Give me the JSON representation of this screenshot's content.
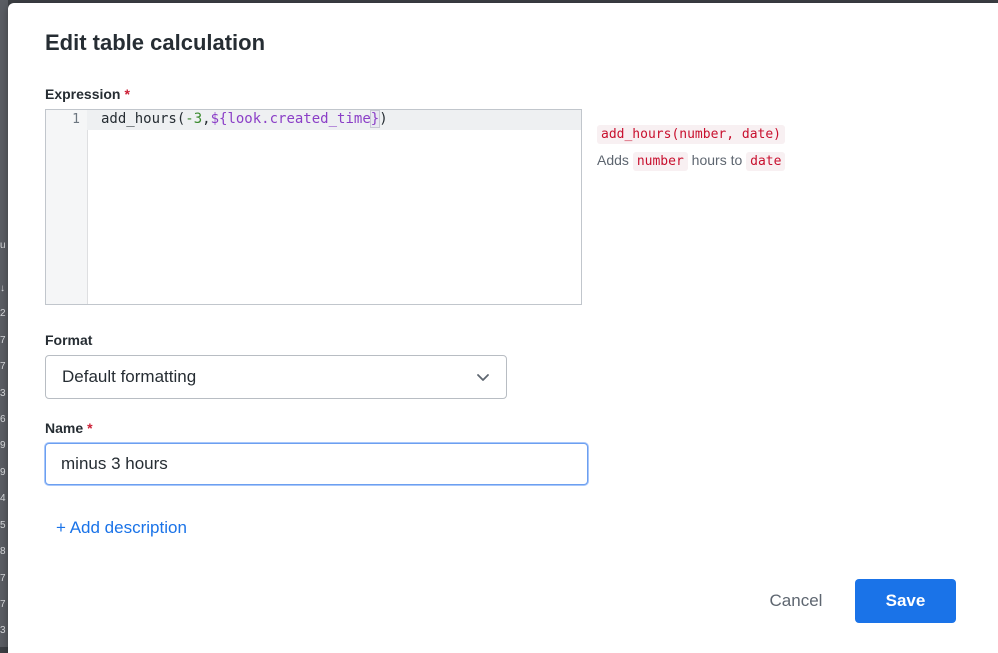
{
  "background": {
    "row_fragments": [
      "u",
      "↓",
      "2",
      "7",
      "7",
      "3",
      "6",
      "9",
      "9",
      "4",
      "5",
      "8",
      "7",
      "7",
      "3"
    ]
  },
  "dialog": {
    "title": "Edit table calculation",
    "expression": {
      "label": "Expression",
      "required_mark": "*",
      "line_number": "1",
      "code": {
        "fn": "add_hours(",
        "num": "-3",
        "comma": ",",
        "field_open": "${",
        "field": "look.created_time",
        "field_close": "}",
        "close": ")"
      }
    },
    "help": {
      "signature": "add_hours(number, date)",
      "desc_prefix": "Adds",
      "desc_arg1": "number",
      "desc_middle": "hours to",
      "desc_arg2": "date"
    },
    "format": {
      "label": "Format",
      "selected": "Default formatting",
      "icon": "chevron-down-icon"
    },
    "name": {
      "label": "Name",
      "required_mark": "*",
      "value": "minus 3 hours"
    },
    "add_description": "+ Add description",
    "actions": {
      "cancel": "Cancel",
      "save": "Save"
    }
  },
  "colors": {
    "primary": "#1a73e8",
    "required": "#cc1f36",
    "code_string": "#c8102e"
  }
}
